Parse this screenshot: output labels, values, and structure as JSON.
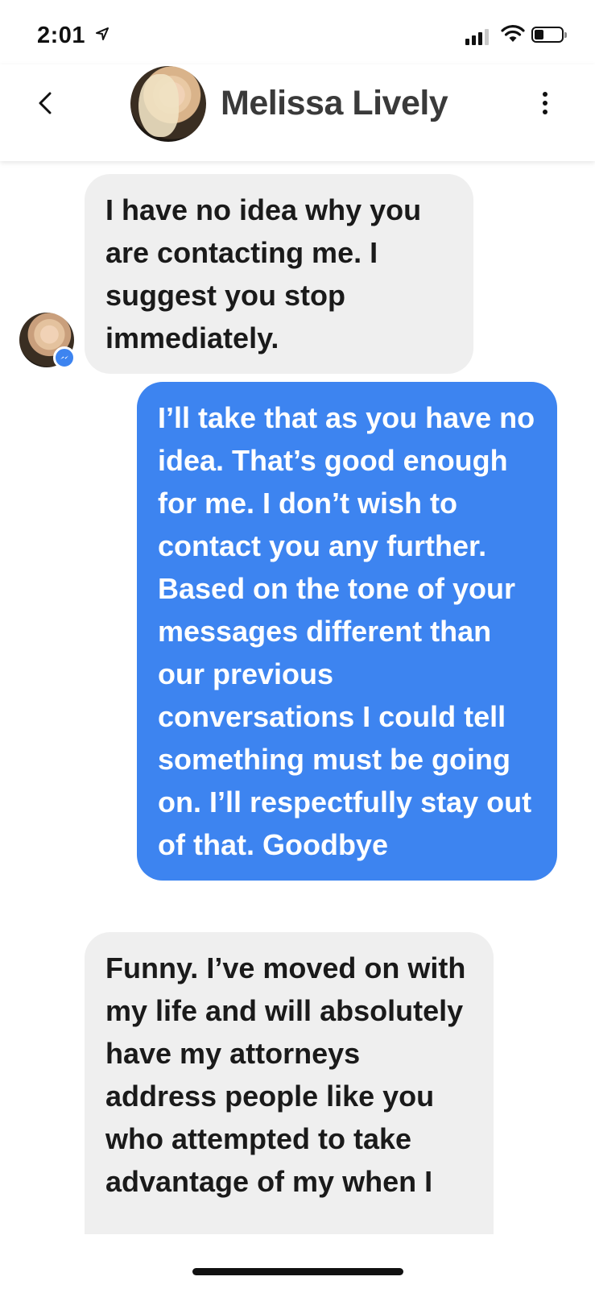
{
  "status_bar": {
    "time": "2:01",
    "location_icon": "location-arrow-icon",
    "signal_icon": "cellular-signal-icon",
    "wifi_icon": "wifi-icon",
    "battery_icon": "battery-icon",
    "battery_level": 0.3
  },
  "header": {
    "back_icon": "chevron-left-icon",
    "contact_name": "Melissa Lively",
    "avatar": "contact-avatar",
    "more_icon": "more-vertical-icon"
  },
  "messages": [
    {
      "direction": "incoming",
      "text": "I have no idea why you are contacting me. I suggest you stop immediately."
    },
    {
      "direction": "outgoing",
      "text": "I’ll take that as you have no idea. That’s good enough for me. I don’t wish to contact you any further. Based on the tone of your messages different than our previous conversations I could tell something must be going on. I’ll respectfully stay out of that. Goodbye"
    },
    {
      "direction": "incoming",
      "text": "Funny. I’ve moved on with my life and will absolutely have my attorneys address people like you who attempted to take advantage of my when I"
    }
  ],
  "colors": {
    "outgoing_bubble": "#3d84f0",
    "incoming_bubble": "#efefef",
    "messenger_badge": "#3d84f0"
  }
}
